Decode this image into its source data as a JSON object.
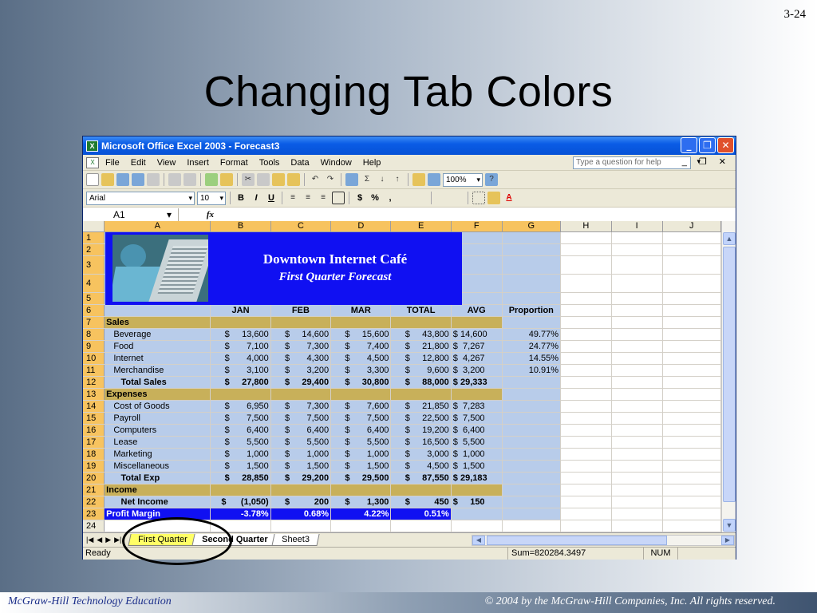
{
  "slide": {
    "number": "3-24",
    "title": "Changing Tab Colors",
    "footer_left": "McGraw-Hill Technology Education",
    "footer_right": "© 2004 by the McGraw-Hill Companies, Inc.  All rights reserved."
  },
  "window": {
    "title": "Microsoft Office Excel 2003 - Forecast3",
    "menus": [
      "File",
      "Edit",
      "View",
      "Insert",
      "Format",
      "Tools",
      "Data",
      "Window",
      "Help"
    ],
    "ask_placeholder": "Type a question for help"
  },
  "toolbar": {
    "zoom": "100%",
    "font": "Arial",
    "size": "10",
    "bold": "B",
    "italic": "I",
    "underline": "U",
    "dollar": "$",
    "percent": "%",
    "comma": ","
  },
  "formula_bar": {
    "name_box": "A1",
    "fx": "fx"
  },
  "sheet": {
    "columns": [
      "A",
      "B",
      "C",
      "D",
      "E",
      "F",
      "G",
      "H",
      "I",
      "J"
    ],
    "banner_title": "Downtown Internet Café",
    "banner_subtitle": "First Quarter Forecast",
    "rows": [
      {
        "n": "1",
        "c": [
          "",
          "",
          "",
          "",
          "",
          "",
          "",
          "",
          "",
          ""
        ]
      },
      {
        "n": "2",
        "c": [
          "",
          "",
          "",
          "",
          "",
          "",
          "",
          "",
          "",
          ""
        ]
      },
      {
        "n": "3",
        "c": [
          "",
          "",
          "",
          "",
          "",
          "",
          "",
          "",
          "",
          ""
        ]
      },
      {
        "n": "4",
        "c": [
          "",
          "",
          "",
          "",
          "",
          "",
          "",
          "",
          "",
          ""
        ]
      },
      {
        "n": "5",
        "c": [
          "",
          "",
          "",
          "",
          "",
          "",
          "",
          "",
          "",
          ""
        ]
      },
      {
        "n": "6",
        "c": [
          "",
          "JAN",
          "FEB",
          "MAR",
          "TOTAL",
          "AVG",
          "Proportion",
          "",
          "",
          ""
        ]
      },
      {
        "n": "7",
        "c": [
          "Sales",
          "",
          "",
          "",
          "",
          "",
          "",
          "",
          "",
          ""
        ]
      },
      {
        "n": "8",
        "c": [
          "   Beverage",
          "$     13,600",
          "$     14,600",
          "$     15,600",
          "$     43,800",
          "$ 14,600",
          "49.77%",
          "",
          "",
          ""
        ]
      },
      {
        "n": "9",
        "c": [
          "   Food",
          "$       7,100",
          "$       7,300",
          "$       7,400",
          "$     21,800",
          "$  7,267",
          "24.77%",
          "",
          "",
          ""
        ]
      },
      {
        "n": "10",
        "c": [
          "   Internet",
          "$       4,000",
          "$       4,300",
          "$       4,500",
          "$     12,800",
          "$  4,267",
          "14.55%",
          "",
          "",
          ""
        ]
      },
      {
        "n": "11",
        "c": [
          "   Merchandise",
          "$       3,100",
          "$       3,200",
          "$       3,300",
          "$       9,600",
          "$  3,200",
          "10.91%",
          "",
          "",
          ""
        ]
      },
      {
        "n": "12",
        "c": [
          "      Total Sales",
          "$     27,800",
          "$     29,400",
          "$     30,800",
          "$     88,000",
          "$ 29,333",
          "",
          "",
          "",
          ""
        ]
      },
      {
        "n": "13",
        "c": [
          "Expenses",
          "",
          "",
          "",
          "",
          "",
          "",
          "",
          "",
          ""
        ]
      },
      {
        "n": "14",
        "c": [
          "   Cost of Goods",
          "$       6,950",
          "$       7,300",
          "$       7,600",
          "$     21,850",
          "$  7,283",
          "",
          "",
          "",
          ""
        ]
      },
      {
        "n": "15",
        "c": [
          "   Payroll",
          "$       7,500",
          "$       7,500",
          "$       7,500",
          "$     22,500",
          "$  7,500",
          "",
          "",
          "",
          ""
        ]
      },
      {
        "n": "16",
        "c": [
          "   Computers",
          "$       6,400",
          "$       6,400",
          "$       6,400",
          "$     19,200",
          "$  6,400",
          "",
          "",
          "",
          ""
        ]
      },
      {
        "n": "17",
        "c": [
          "   Lease",
          "$       5,500",
          "$       5,500",
          "$       5,500",
          "$     16,500",
          "$  5,500",
          "",
          "",
          "",
          ""
        ]
      },
      {
        "n": "18",
        "c": [
          "   Marketing",
          "$       1,000",
          "$       1,000",
          "$       1,000",
          "$       3,000",
          "$  1,000",
          "",
          "",
          "",
          ""
        ]
      },
      {
        "n": "19",
        "c": [
          "   Miscellaneous",
          "$       1,500",
          "$       1,500",
          "$       1,500",
          "$       4,500",
          "$  1,500",
          "",
          "",
          "",
          ""
        ]
      },
      {
        "n": "20",
        "c": [
          "      Total Exp",
          "$     28,850",
          "$     29,200",
          "$     29,500",
          "$     87,550",
          "$ 29,183",
          "",
          "",
          "",
          ""
        ]
      },
      {
        "n": "21",
        "c": [
          "Income",
          "",
          "",
          "",
          "",
          "",
          "",
          "",
          "",
          ""
        ]
      },
      {
        "n": "22",
        "c": [
          "      Net Income",
          "$      (1,050)",
          "$          200",
          "$       1,300",
          "$          450",
          "$     150",
          "",
          "",
          "",
          ""
        ]
      },
      {
        "n": "23",
        "c": [
          "Profit Margin",
          "-3.78%",
          "0.68%",
          "4.22%",
          "0.51%",
          "",
          "",
          "",
          "",
          ""
        ]
      },
      {
        "n": "24",
        "c": [
          "",
          "",
          "",
          "",
          "",
          "",
          "",
          "",
          "",
          ""
        ]
      }
    ],
    "tabs": [
      "First Quarter",
      "Second Quarter",
      "Sheet3"
    ]
  },
  "status": {
    "ready": "Ready",
    "sum": "Sum=820284.3497",
    "num": "NUM"
  },
  "colors": {
    "tab_highlight": "#ffff66",
    "banner_blue": "#1010f2",
    "section_gold": "#c8b05a",
    "selection_blue": "#b8ccea"
  }
}
